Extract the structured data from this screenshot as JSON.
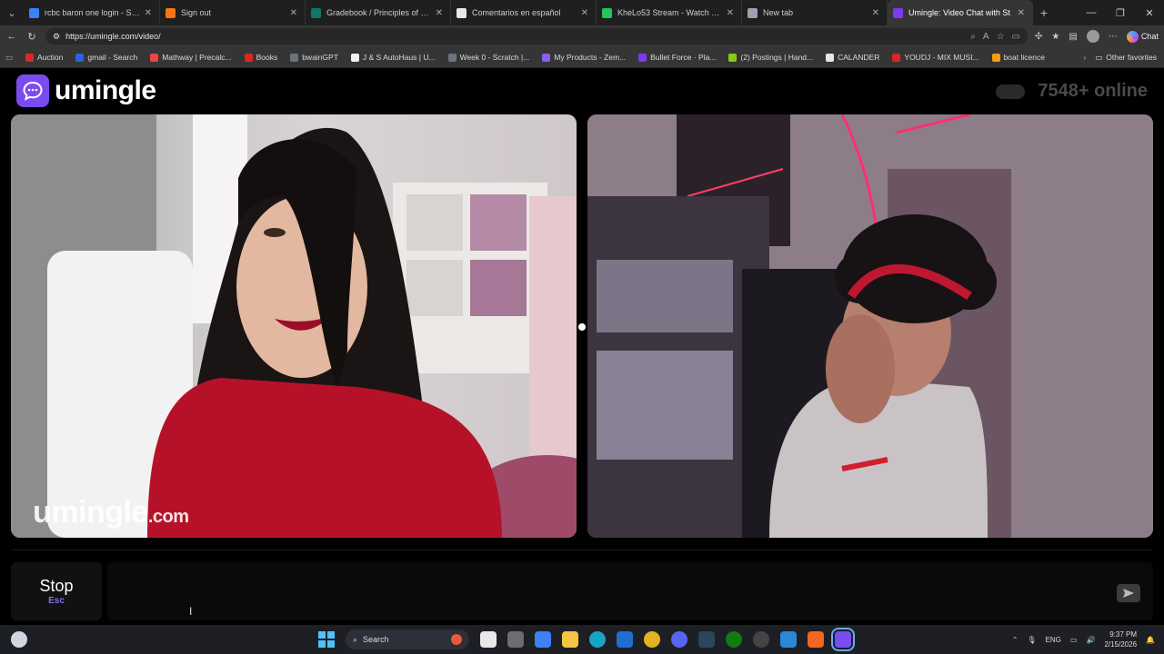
{
  "browser": {
    "tabs": [
      {
        "label": "rcbc baron one login - Search",
        "color": "#3b82f6",
        "active": false
      },
      {
        "label": "Sign out",
        "color": "#f97316",
        "active": false
      },
      {
        "label": "Gradebook / Principles of Sociolo",
        "color": "#0f766e",
        "active": false
      },
      {
        "label": "Comentarios en español",
        "color": "#e5e7eb",
        "active": false
      },
      {
        "label": "KheLo53 Stream - Watch Live on K",
        "color": "#22c55e",
        "active": false
      },
      {
        "label": "New tab",
        "color": "#9ca3af",
        "active": false
      },
      {
        "label": "Umingle: Video Chat with St",
        "color": "#7c3aed",
        "active": true
      }
    ],
    "url": "https://umingle.com/video/",
    "chat_label": "Chat",
    "bookmarks": [
      {
        "label": "Auction",
        "color": "#dc2626"
      },
      {
        "label": "gmail - Search",
        "color": "#2563eb"
      },
      {
        "label": "Mathway | Precalc...",
        "color": "#ef4444"
      },
      {
        "label": "Books",
        "color": "#dc2626"
      },
      {
        "label": "bwainGPT",
        "color": "#6b7280"
      },
      {
        "label": "J & S AutoHaus | U...",
        "color": "#f3f4f6"
      },
      {
        "label": "Week 0 - Scratch |...",
        "color": "#6b7280"
      },
      {
        "label": "My Products - Zem...",
        "color": "#8b5cf6"
      },
      {
        "label": "Bullet Force · Pla...",
        "color": "#7c3aed"
      },
      {
        "label": "(2) Postings | Hand...",
        "color": "#84cc16"
      },
      {
        "label": "CALANDER",
        "color": "#e5e7eb"
      },
      {
        "label": "YOUDJ - MIX MUSI...",
        "color": "#dc2626"
      },
      {
        "label": "boat licence",
        "color": "#f59e0b"
      }
    ],
    "other_favorites": "Other favorites"
  },
  "page": {
    "logo_text": "umingle",
    "online_count": "7548+ online",
    "watermark": "umingle",
    "watermark_suffix": ".com",
    "stop_label": "Stop",
    "stop_key": "Esc"
  },
  "taskbar": {
    "search_label": "Search",
    "lang": "ENG",
    "time": "9:37 PM",
    "date": "2/15/2026"
  }
}
